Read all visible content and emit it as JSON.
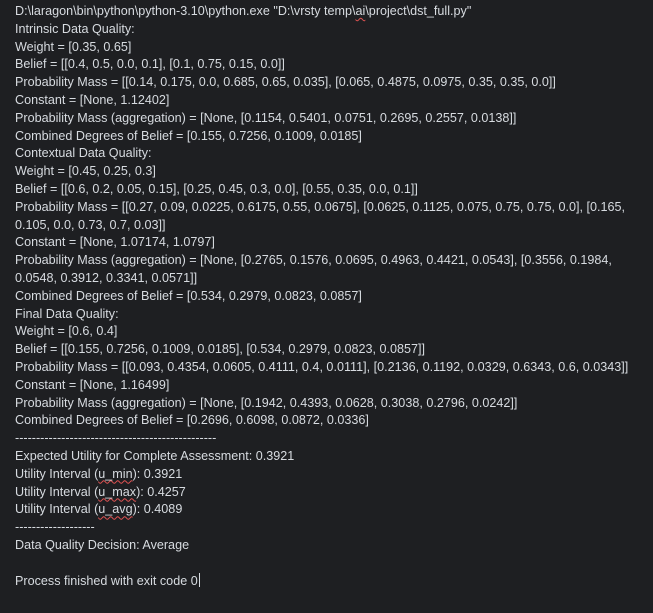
{
  "console": {
    "command": {
      "pre": "D:\\laragon\\bin\\python\\python-3.10\\python.exe \"D:\\vrsty temp\\",
      "flag": "ai",
      "post": "\\project\\dst_full.py\""
    },
    "intrinsic": {
      "heading": "Intrinsic Data Quality:",
      "weight": "Weight = [0.35, 0.65]",
      "belief": "Belief = [[0.4, 0.5, 0.0, 0.1], [0.1, 0.75, 0.15, 0.0]]",
      "prob_mass": "Probability Mass = [[0.14, 0.175, 0.0, 0.685, 0.65, 0.035], [0.065, 0.4875, 0.0975, 0.35, 0.35, 0.0]]",
      "constant": "Constant = [None, 1.12402]",
      "prob_mass_agg": "Probability Mass (aggregation) = [None, [0.1154, 0.5401, 0.0751, 0.2695, 0.2557, 0.0138]]",
      "combined": "Combined Degrees of Belief = [0.155, 0.7256, 0.1009, 0.0185]"
    },
    "contextual": {
      "heading": "Contextual Data Quality:",
      "weight": "Weight = [0.45, 0.25, 0.3]",
      "belief": "Belief = [[0.6, 0.2, 0.05, 0.15], [0.25, 0.45, 0.3, 0.0], [0.55, 0.35, 0.0, 0.1]]",
      "prob_mass": "Probability Mass = [[0.27, 0.09, 0.0225, 0.6175, 0.55, 0.0675], [0.0625, 0.1125, 0.075, 0.75, 0.75, 0.0], [0.165, 0.105, 0.0, 0.73, 0.7, 0.03]]",
      "constant": "Constant = [None, 1.07174, 1.0797]",
      "prob_mass_agg": "Probability Mass (aggregation) = [None, [0.2765, 0.1576, 0.0695, 0.4963, 0.4421, 0.0543], [0.3556, 0.1984, 0.0548, 0.3912, 0.3341, 0.0571]]",
      "combined": "Combined Degrees of Belief = [0.534, 0.2979, 0.0823, 0.0857]"
    },
    "final": {
      "heading": "Final Data Quality:",
      "weight": "Weight = [0.6, 0.4]",
      "belief": "Belief = [[0.155, 0.7256, 0.1009, 0.0185], [0.534, 0.2979, 0.0823, 0.0857]]",
      "prob_mass": "Probability Mass = [[0.093, 0.4354, 0.0605, 0.4111, 0.4, 0.0111], [0.2136, 0.1192, 0.0329, 0.6343, 0.6, 0.0343]]",
      "constant": "Constant = [None, 1.16499]",
      "prob_mass_agg": "Probability Mass (aggregation) = [None, [0.1942, 0.4393, 0.0628, 0.3038, 0.2796, 0.0242]]",
      "combined": "Combined Degrees of Belief = [0.2696, 0.6098, 0.0872, 0.0336]"
    },
    "separator_long": "------------------------------------------------",
    "utility": {
      "expected": "Expected Utility for Complete Assessment: 0.3921",
      "min": {
        "pre": "Utility Interval (",
        "flag": "u_min",
        "post": "): 0.3921"
      },
      "max": {
        "pre": "Utility Interval (",
        "flag": "u_max",
        "post": "): 0.4257"
      },
      "avg": {
        "pre": "Utility Interval (",
        "flag": "u_avg",
        "post": "): 0.4089"
      }
    },
    "separator_short": "-------------------",
    "decision": "Data Quality Decision: Average",
    "exit": "Process finished with exit code 0"
  }
}
